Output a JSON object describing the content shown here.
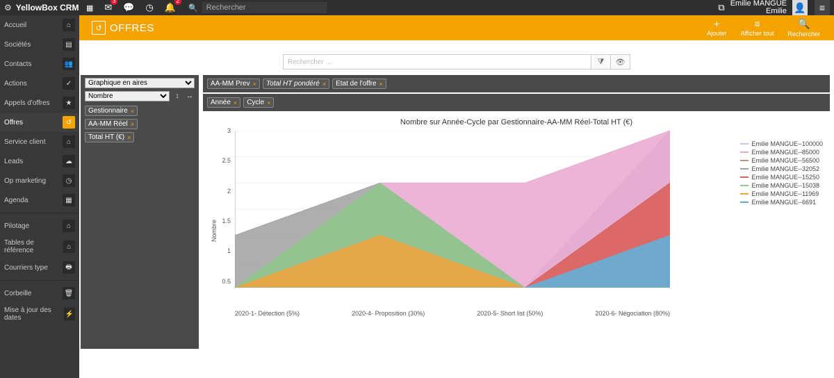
{
  "brand": "YellowBox CRM",
  "top_search_placeholder": "Rechercher",
  "badges": {
    "mail": "3",
    "bell": "2"
  },
  "user": {
    "fullname": "Emilie MANGUE",
    "short": "Emilie"
  },
  "sidebar": {
    "items": [
      {
        "label": "Accueil",
        "icon": "⌂"
      },
      {
        "label": "Sociétés",
        "icon": "▤"
      },
      {
        "label": "Contacts",
        "icon": "👥"
      },
      {
        "label": "Actions",
        "icon": "✓"
      },
      {
        "label": "Appels d'offres",
        "icon": "★"
      },
      {
        "label": "Offres",
        "icon": "↺",
        "active": true
      },
      {
        "label": "Service client",
        "icon": "⌂"
      },
      {
        "label": "Leads",
        "icon": "☁"
      },
      {
        "label": "Op marketing",
        "icon": "◷"
      },
      {
        "label": "Agenda",
        "icon": "▦"
      }
    ],
    "items2": [
      {
        "label": "Pilotage",
        "icon": "⌂"
      },
      {
        "label": "Tables de référence",
        "icon": "⌂"
      },
      {
        "label": "Courriers type",
        "icon": "🖶"
      }
    ],
    "items3": [
      {
        "label": "Corbeille",
        "icon": "🗑"
      },
      {
        "label": "Mise à jour des dates",
        "icon": "⚡"
      }
    ]
  },
  "page": {
    "title": "OFFRES",
    "actions": [
      {
        "icon": "+",
        "label": "Ajouter"
      },
      {
        "icon": "≡",
        "label": "Afficher tout"
      },
      {
        "icon": "🔍",
        "label": "Rechercher"
      }
    ]
  },
  "searchrow": {
    "placeholder": "Rechercher ..."
  },
  "leftpanel": {
    "chart_type_select": "Graphique en aires",
    "value_select": "Nombre",
    "tags": [
      "Gestionnaire",
      "AA-MM Réel",
      "Total HT (€)"
    ]
  },
  "topbar_tags": [
    "AA-MM Prev",
    "Total HT pondéré",
    "Etat de l'offre"
  ],
  "botbar_tags": [
    "Année",
    "Cycle"
  ],
  "chart_data": {
    "type": "area",
    "title": "Nombre sur Année-Cycle par Gestionnaire-AA-MM Réel-Total HT (€)",
    "ylabel": "Nombre",
    "xlabel": "",
    "ylim": [
      0,
      3
    ],
    "yticks": [
      0.5,
      1,
      1.5,
      2,
      2.5,
      3
    ],
    "categories": [
      "2020-1- Détection (5%)",
      "2020-4- Proposition (30%)",
      "2020-5- Short list (50%)",
      "2020-6- Négociation (80%)"
    ],
    "series": [
      {
        "name": "Emilie MANGUE--100000",
        "color": "#cbc5e0",
        "values": [
          0,
          0,
          0,
          3
        ]
      },
      {
        "name": "Emilie MANGUE--85000",
        "color": "#e9a7cf",
        "values": [
          0,
          2,
          2,
          3
        ]
      },
      {
        "name": "Emilie MANGUE--56500",
        "color": "#b49684",
        "values": [
          0,
          2,
          0,
          2
        ]
      },
      {
        "name": "Emilie MANGUE--32052",
        "color": "#a0a0a0",
        "values": [
          1,
          2,
          0,
          0
        ]
      },
      {
        "name": "Emilie MANGUE--15250",
        "color": "#e06060",
        "values": [
          0,
          0,
          0,
          2
        ]
      },
      {
        "name": "Emilie MANGUE--15038",
        "color": "#92c98f",
        "values": [
          0,
          2,
          0,
          1
        ]
      },
      {
        "name": "Emilie MANGUE--11969",
        "color": "#f2a23a",
        "values": [
          0,
          1,
          0,
          0
        ]
      },
      {
        "name": "Emilie MANGUE--6691",
        "color": "#6aa6d8",
        "values": [
          0,
          0,
          0,
          1
        ]
      }
    ]
  }
}
